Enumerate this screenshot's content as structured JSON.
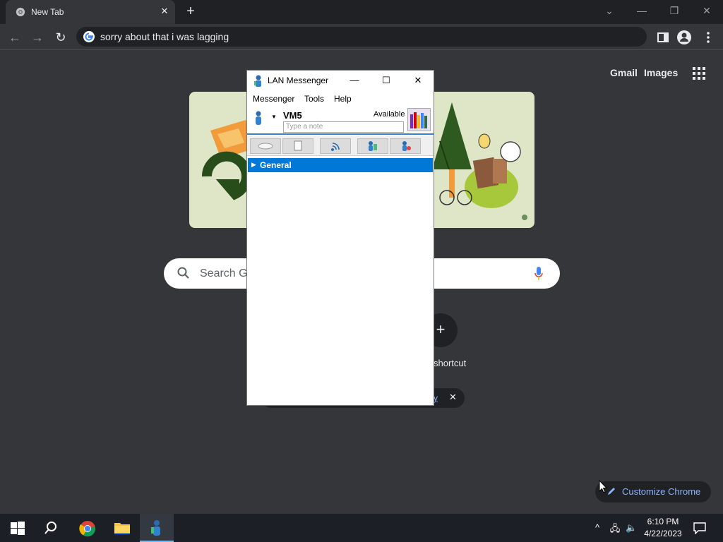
{
  "browser": {
    "tab_title": "New Tab",
    "address_text": "sorry about that i was lagging"
  },
  "ntp": {
    "gmail_label": "Gmail",
    "images_label": "Images",
    "search_placeholder": "Search Go",
    "shortcut_label": "shortcut",
    "chip_link_text": "y",
    "customize_label": "Customize Chrome"
  },
  "lan_messenger": {
    "title": "LAN Messenger",
    "menus": [
      "Messenger",
      "Tools",
      "Help"
    ],
    "user_name": "VM5",
    "status": "Available",
    "note_placeholder": "Type a note",
    "group_name": "General"
  },
  "taskbar": {
    "time": "6:10 PM",
    "date": "4/22/2023"
  },
  "colors": {
    "group_highlight": "#0078d7",
    "link_blue": "#8ab4f8",
    "chrome_bg": "#35363a"
  }
}
